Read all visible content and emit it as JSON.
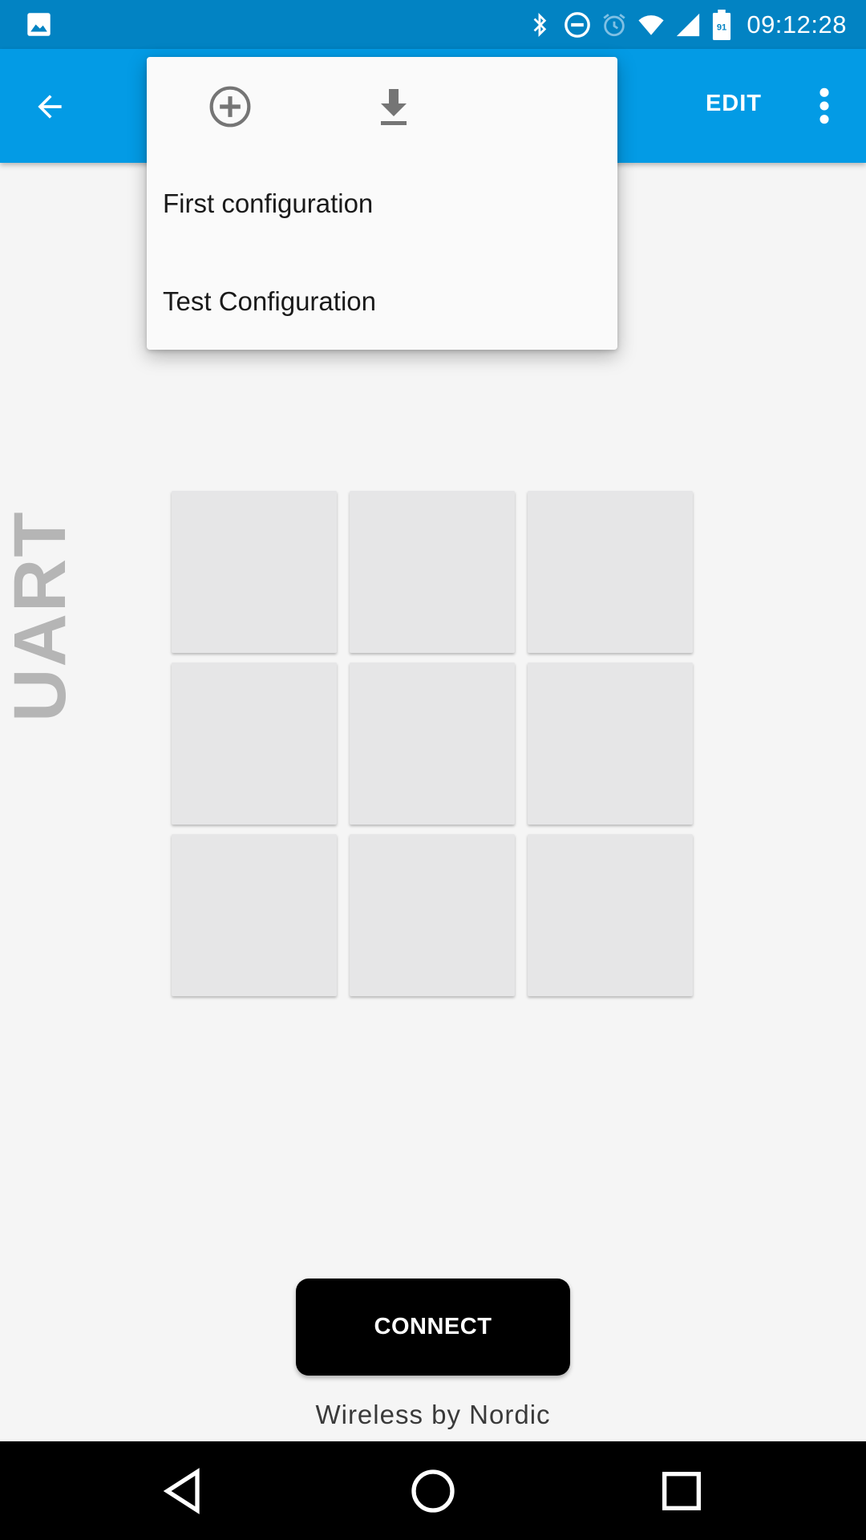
{
  "status_bar": {
    "time": "09:12:28",
    "battery_level": "91",
    "icons": [
      "image-icon",
      "bluetooth-icon",
      "do-not-disturb-icon",
      "alarm-icon",
      "wifi-icon",
      "cellular-signal-icon",
      "battery-icon"
    ]
  },
  "app_bar": {
    "back_icon": "arrow-back-icon",
    "edit_label": "EDIT",
    "overflow_icon": "more-vert-icon"
  },
  "popup_menu": {
    "actions": [
      "add-circle-icon",
      "download-icon"
    ],
    "items": [
      {
        "label": "First configuration"
      },
      {
        "label": "Test Configuration"
      }
    ]
  },
  "side_label": "UART",
  "grid": {
    "rows": 3,
    "cols": 3
  },
  "connect_button": "CONNECT",
  "footer": "Wireless by Nordic",
  "nav_bar": {
    "icons": [
      "nav-back-icon",
      "nav-home-icon",
      "nav-recents-icon"
    ]
  },
  "colors": {
    "status_bar": "#0283c3",
    "app_bar": "#039be5",
    "background": "#f5f5f5",
    "grid_cell": "#e6e6e7",
    "connect_button": "#000000"
  }
}
